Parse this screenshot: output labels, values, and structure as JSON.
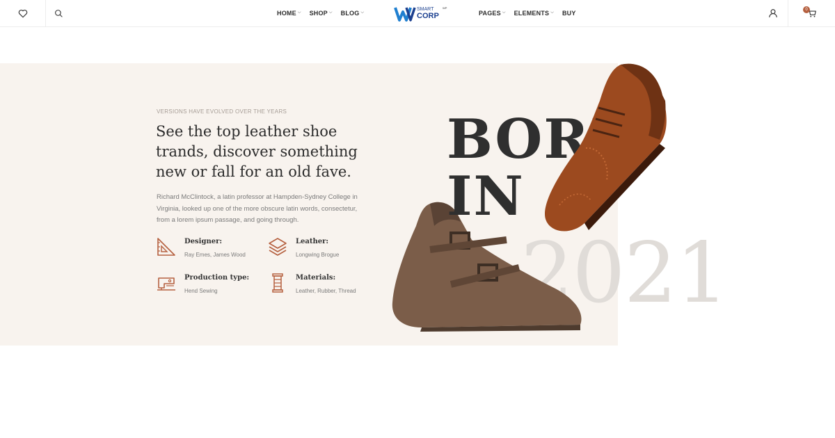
{
  "header": {
    "nav_left": [
      {
        "label": "HOME",
        "has_dropdown": true
      },
      {
        "label": "SHOP",
        "has_dropdown": true
      },
      {
        "label": "BLOG",
        "has_dropdown": true
      }
    ],
    "nav_right": [
      {
        "label": "PAGES",
        "has_dropdown": true
      },
      {
        "label": "ELEMENTS",
        "has_dropdown": true
      },
      {
        "label": "BUY",
        "has_dropdown": false
      }
    ],
    "logo": {
      "text_top": "SMART",
      "text_main": "CORP",
      "tagline": ""
    },
    "cart_count": "0"
  },
  "hero": {
    "eyebrow": "VERSIONS HAVE EVOLVED OVER THE YEARS",
    "headline": "See the top leather shoe trands, discover something new or fall for an old fave.",
    "paragraph": "Richard McClintock, a latin professor at Hampden-Sydney College in Virginia, looked up one of the more obscure latin words, consectetur, from a lorem ipsum passage, and going through.",
    "features": [
      {
        "title": "Designer:",
        "value": "Ray Emes, James Wood",
        "icon": "set-square-icon"
      },
      {
        "title": "Leather:",
        "value": "Longwing Brogue",
        "icon": "layers-icon"
      },
      {
        "title": "Production type:",
        "value": "Hend Sewing",
        "icon": "sewing-machine-icon"
      },
      {
        "title": "Materials:",
        "value": "Leather, Rubber, Thread",
        "icon": "thread-spool-icon"
      }
    ],
    "big_text_line1": "BORN",
    "big_text_line2": "IN",
    "year": "2021"
  },
  "colors": {
    "accent": "#b5603f",
    "hero_bg": "#f8f3ee",
    "year_text": "#e0dcd8"
  }
}
